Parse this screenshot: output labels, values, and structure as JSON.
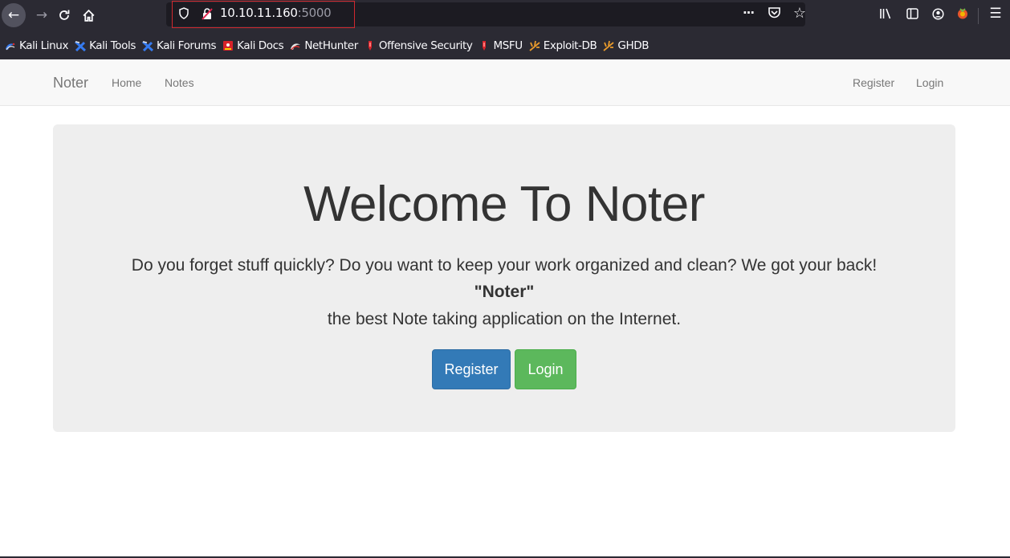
{
  "browser": {
    "url_host": "10.10.11.160",
    "url_port": ":5000",
    "bookmarks": [
      {
        "label": "Kali Linux",
        "icon": "kali-dragon-icon"
      },
      {
        "label": "Kali Tools",
        "icon": "kali-tools-icon"
      },
      {
        "label": "Kali Forums",
        "icon": "kali-forums-icon"
      },
      {
        "label": "Kali Docs",
        "icon": "kali-docs-icon"
      },
      {
        "label": "NetHunter",
        "icon": "nethunter-icon"
      },
      {
        "label": "Offensive Security",
        "icon": "offsec-icon"
      },
      {
        "label": "MSFU",
        "icon": "msfu-icon"
      },
      {
        "label": "Exploit-DB",
        "icon": "exploitdb-icon"
      },
      {
        "label": "GHDB",
        "icon": "ghdb-icon"
      }
    ],
    "colors": {
      "chrome": "#2b2a33",
      "urlbar": "#1c1b22",
      "highlight": "#d0282e"
    }
  },
  "navbar": {
    "brand": "Noter",
    "links": [
      "Home",
      "Notes"
    ],
    "right_links": [
      "Register",
      "Login"
    ]
  },
  "jumbotron": {
    "title": "Welcome To Noter",
    "line1": "Do you forget stuff quickly? Do you want to keep your work organized and clean? We got your back!",
    "line2": "\"Noter\"",
    "line3": "the best Note taking application on the Internet.",
    "register_button": "Register",
    "login_button": "Login"
  },
  "colors": {
    "primary": "#337ab7",
    "success": "#5cb85c",
    "jumbotron_bg": "#eeeeee"
  }
}
